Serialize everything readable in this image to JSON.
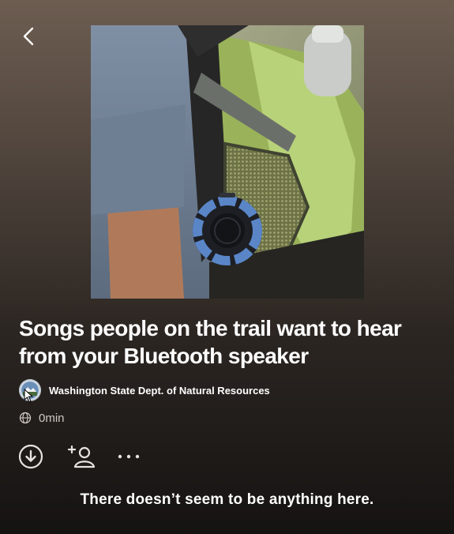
{
  "header": {
    "back_icon": "chevron-left-icon"
  },
  "playlist": {
    "title": "Songs people on the trail want to hear from your Bluetooth speaker",
    "owner": "Washington State Dept. of Natural Resources",
    "duration": "0min"
  },
  "actions": [
    {
      "name": "download",
      "icon": "download-icon"
    },
    {
      "name": "add-collaborator",
      "icon": "add-user-icon"
    },
    {
      "name": "more-options",
      "icon": "more-horizontal-icon"
    }
  ],
  "empty_state": {
    "message": "There doesn’t seem to be anything here."
  },
  "colors": {
    "background_top": "#6d5d51",
    "background_bottom": "#151312",
    "text_primary": "#ffffff",
    "text_secondary": "#cfc8c2",
    "speaker_accent": "#5a86c8"
  }
}
